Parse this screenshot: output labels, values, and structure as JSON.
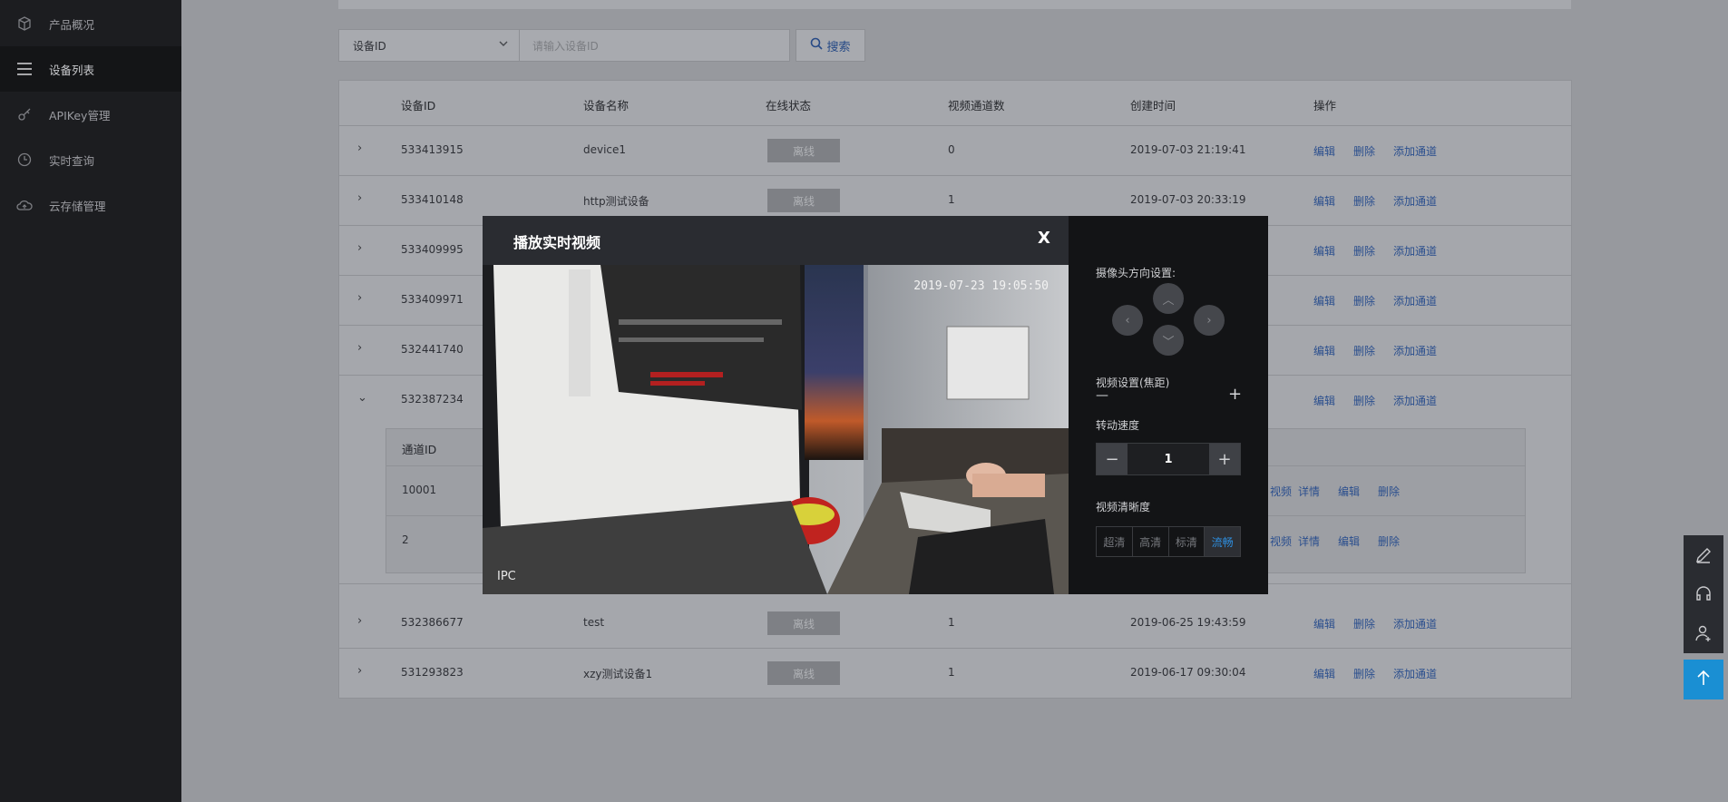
{
  "sidebar": {
    "items": [
      {
        "label": "产品概况",
        "icon": "cube-icon"
      },
      {
        "label": "设备列表",
        "icon": "list-icon",
        "active": true
      },
      {
        "label": "APIKey管理",
        "icon": "key-icon"
      },
      {
        "label": "实时查询",
        "icon": "clock-icon"
      },
      {
        "label": "云存储管理",
        "icon": "cloud-icon"
      }
    ]
  },
  "search": {
    "select_value": "设备ID",
    "placeholder": "请输入设备ID",
    "button_label": "搜索"
  },
  "table": {
    "headers": [
      "设备ID",
      "设备名称",
      "在线状态",
      "视频通道数",
      "创建时间",
      "操作"
    ],
    "actions": {
      "edit": "编辑",
      "delete": "删除",
      "add_channel": "添加通道"
    },
    "rows": [
      {
        "id": "533413915",
        "name": "device1",
        "status": "离线",
        "channels": "0",
        "created": "2019-07-03 21:19:41"
      },
      {
        "id": "533410148",
        "name": "http测试设备",
        "status": "离线",
        "channels": "1",
        "created": "2019-07-03 20:33:19"
      },
      {
        "id": "533409995"
      },
      {
        "id": "533409971"
      },
      {
        "id": "532441740"
      },
      {
        "id": "532387234",
        "expanded": true
      },
      {
        "id": "532386677",
        "name": "test",
        "status": "离线",
        "channels": "1",
        "created": "2019-06-25 19:43:59"
      },
      {
        "id": "531293823",
        "name": "xzy测试设备1",
        "status": "离线",
        "channels": "1",
        "created": "2019-06-17 09:30:04"
      }
    ],
    "subtable": {
      "header": "通道ID",
      "rows": [
        {
          "id": "10001",
          "actions": [
            "视频",
            "详情",
            "编辑",
            "删除"
          ]
        },
        {
          "id": "2",
          "actions": [
            "视频",
            "详情",
            "编辑",
            "删除"
          ]
        }
      ]
    }
  },
  "modal": {
    "title": "播放实时视频",
    "close_label": "X",
    "video": {
      "timestamp": "2019-07-23 19:05:50",
      "source_tag": "IPC"
    },
    "panel": {
      "direction_label": "摄像头方向设置:",
      "zoom_label": "视频设置(焦距)",
      "zoom_minus": "—",
      "zoom_plus": "+",
      "speed_label": "转动速度",
      "speed_value": "1",
      "speed_minus": "−",
      "speed_plus": "+",
      "quality_label": "视频清晰度",
      "quality_options": [
        "超清",
        "高清",
        "标清",
        "流畅"
      ],
      "quality_selected": "流畅"
    }
  },
  "colors": {
    "sidebar_bg": "#1c1d20",
    "overlay_bg": "#97999e",
    "link": "#2b4f8e",
    "accent": "#1a8fd3",
    "quality_active": "#2e8fe0"
  }
}
